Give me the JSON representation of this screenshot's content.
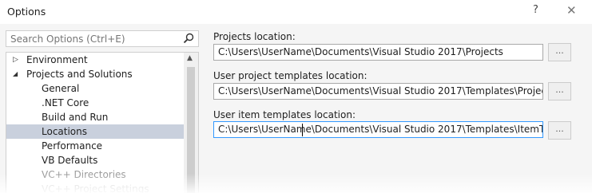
{
  "window": {
    "title": "Options",
    "help_glyph": "?",
    "close_glyph": "✕"
  },
  "search": {
    "placeholder": "Search Options (Ctrl+E)"
  },
  "tree": {
    "items": [
      {
        "label": "Environment",
        "expander": "▷"
      },
      {
        "label": "Projects and Solutions",
        "expander": "◢"
      },
      {
        "label": "General"
      },
      {
        "label": ".NET Core"
      },
      {
        "label": "Build and Run"
      },
      {
        "label": "Locations",
        "selected": true
      },
      {
        "label": "Performance"
      },
      {
        "label": "VB Defaults"
      },
      {
        "label": "VC++ Directories"
      },
      {
        "label": "VC++ Project Settings"
      }
    ],
    "scroll_up_glyph": "▲"
  },
  "fields": {
    "projects": {
      "label": "Projects location:",
      "value": "C:\\Users\\UserName\\Documents\\Visual Studio 2017\\Projects",
      "browse": "..."
    },
    "project_templates": {
      "label": "User project templates location:",
      "value": "C:\\Users\\UserName\\Documents\\Visual Studio 2017\\Templates\\ProjectTemplates",
      "browse": "..."
    },
    "item_templates": {
      "label": "User item templates location:",
      "value": "C:\\Users\\UserName\\Documents\\Visual Studio 2017\\Templates\\ItemTemplates",
      "browse": "..."
    }
  }
}
